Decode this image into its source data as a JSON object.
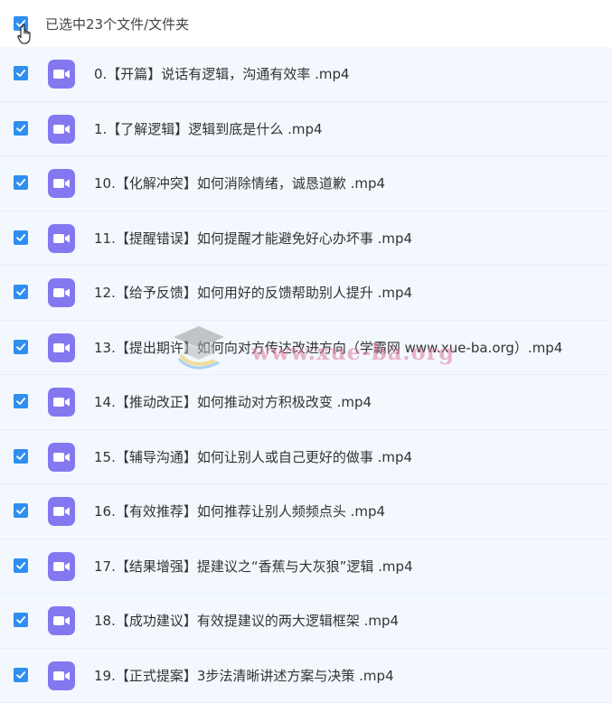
{
  "header": {
    "title": "已选中23个文件/文件夹",
    "select_all_checked": true
  },
  "icons": {
    "checkbox": "checkbox-checked-icon",
    "file": "video-file-icon",
    "cursor": "hand-cursor-icon"
  },
  "colors": {
    "accent": "#2f8ff0",
    "file_icon": "#8378f0",
    "row_background": "#f3f8fe"
  },
  "files": [
    {
      "name": "0.【开篇】说话有逻辑，沟通有效率 .mp4"
    },
    {
      "name": "1.【了解逻辑】逻辑到底是什么 .mp4"
    },
    {
      "name": "10.【化解冲突】如何消除情绪，诚恳道歉 .mp4"
    },
    {
      "name": "11.【提醒错误】如何提醒才能避免好心办坏事 .mp4"
    },
    {
      "name": "12.【给予反馈】如何用好的反馈帮助别人提升 .mp4"
    },
    {
      "name": "13.【提出期许】如何向对方传达改进方向（学霸网 www.xue-ba.org）.mp4"
    },
    {
      "name": "14.【推动改正】如何推动对方积极改变 .mp4"
    },
    {
      "name": "15.【辅导沟通】如何让别人或自己更好的做事 .mp4"
    },
    {
      "name": "16.【有效推荐】如何推荐让别人频频点头 .mp4"
    },
    {
      "name": "17.【结果增强】提建议之“香蕉与大灰狼”逻辑 .mp4"
    },
    {
      "name": "18.【成功建议】有效提建议的两大逻辑框架 .mp4"
    },
    {
      "name": "19.【正式提案】3步法清晰讲述方案与决策 .mp4"
    }
  ],
  "watermark": {
    "text": "www.xue-ba.org"
  }
}
